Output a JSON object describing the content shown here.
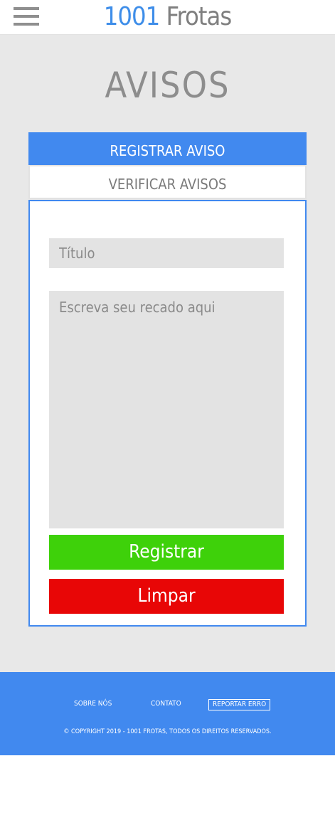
{
  "header": {
    "menu_icon": "hamburger-menu-icon",
    "logo_number": "1001",
    "logo_name": "Frotas"
  },
  "page": {
    "title": "AVISOS"
  },
  "tabs": {
    "register_label": "REGISTRAR AVISO",
    "check_label": "VERIFICAR AVISOS"
  },
  "form": {
    "title_placeholder": "Título",
    "message_placeholder": "Escreva seu recado aqui",
    "register_button": "Registrar",
    "clear_button": "Limpar"
  },
  "footer": {
    "about_label": "SOBRE NÓS",
    "contact_label": "CONTATO",
    "report_label": "REPORTAR ERRO",
    "copyright": "© COPYRIGHT 2019 - 1001 FROTAS, TODOS OS DIREITOS RESERVADOS."
  },
  "colors": {
    "accent_blue": "#4189ef",
    "register_green": "#3ed10a",
    "clear_red": "#e80606",
    "background_gray": "#e8e8e8"
  }
}
